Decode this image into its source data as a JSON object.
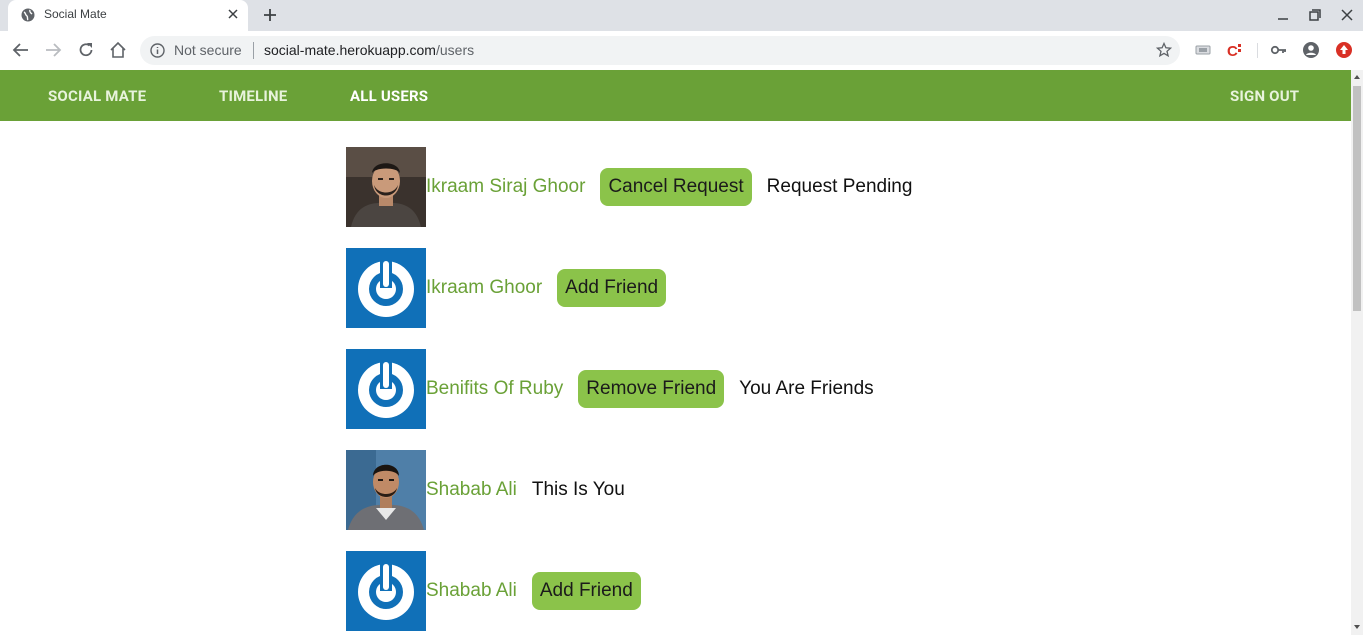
{
  "browser": {
    "tab_title": "Social Mate",
    "security_label": "Not secure",
    "url_host": "social-mate.herokuapp.com",
    "url_path": "/users"
  },
  "nav": {
    "brand": "SOCIAL MATE",
    "timeline": "TIMELINE",
    "all_users": "ALL USERS",
    "sign_out": "SIGN OUT"
  },
  "users": [
    {
      "name": "Ikraam Siraj Ghoor",
      "button": "Cancel Request",
      "status": "Request Pending",
      "avatar": "photo-man-1"
    },
    {
      "name": "Ikraam Ghoor",
      "button": "Add Friend",
      "status": "",
      "avatar": "default-power-icon"
    },
    {
      "name": "Benifits Of Ruby",
      "button": "Remove Friend",
      "status": "You Are Friends",
      "avatar": "default-power-icon"
    },
    {
      "name": "Shabab Ali",
      "button": "",
      "status": "This Is You",
      "avatar": "photo-man-2"
    },
    {
      "name": "Shabab Ali",
      "button": "Add Friend",
      "status": "",
      "avatar": "default-power-icon"
    }
  ],
  "colors": {
    "nav_bg": "#6aa137",
    "button_bg": "#8bc34a",
    "link": "#6aa137",
    "default_avatar_bg": "#1070b8"
  }
}
